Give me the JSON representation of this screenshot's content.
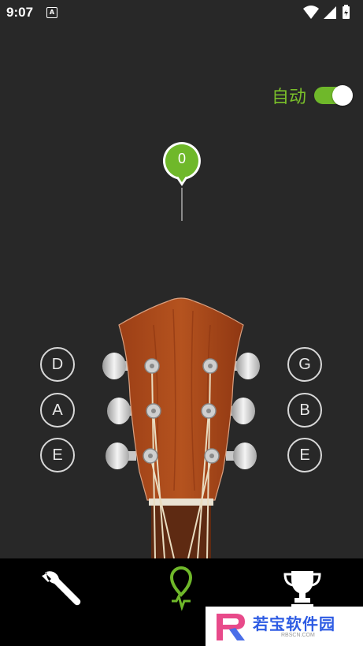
{
  "status_bar": {
    "time": "9:07",
    "notification_icon": "A"
  },
  "auto_mode": {
    "label": "自动",
    "enabled": true,
    "accent_color": "#6fb82a"
  },
  "tuner": {
    "cents_value": "0",
    "indicator_color": "#6fb82a"
  },
  "strings_left": [
    {
      "note": "D"
    },
    {
      "note": "A"
    },
    {
      "note": "E"
    }
  ],
  "strings_right": [
    {
      "note": "G"
    },
    {
      "note": "B"
    },
    {
      "note": "E"
    }
  ],
  "bottom_nav": [
    {
      "icon": "wrench-icon",
      "selected": false
    },
    {
      "icon": "tuner-pin-icon",
      "selected": true
    },
    {
      "icon": "trophy-icon",
      "selected": false
    }
  ],
  "watermark": {
    "text": "若宝软件园",
    "sub": "RBSCN.COM"
  }
}
